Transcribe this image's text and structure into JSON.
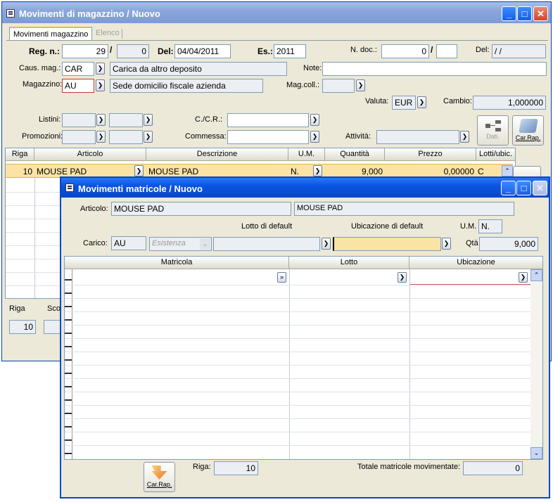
{
  "main": {
    "title": "Movimenti di magazzino / Nuovo",
    "tabs": [
      "Movimenti magazzino",
      "Elenco"
    ],
    "reg_n_label": "Reg. n.:",
    "reg_n": "29",
    "reg_sep": "/",
    "reg_n2": "0",
    "del_label": "Del:",
    "del_date": "04/04/2011",
    "es_label": "Es.:",
    "es": "2011",
    "ndoc_label": "N. doc.:",
    "ndoc": "0",
    "ndoc_sep": "/",
    "ndoc2": "",
    "del2_label": "Del:",
    "del2": "/ /",
    "caus_label": "Caus. mag.:",
    "caus_code": "CAR",
    "caus_desc": "Carica da altro deposito",
    "note_label": "Note:",
    "note": "",
    "magazzino_label": "Magazzino:",
    "magazzino_code": "AU",
    "magazzino_desc": "Sede domicilio fiscale azienda",
    "magcoll_label": "Mag.coll.:",
    "magcoll": "",
    "valuta_label": "Valuta:",
    "valuta": "EUR",
    "cambio_label": "Cambio:",
    "cambio": "1,000000",
    "listini_label": "Listini:",
    "promozioni_label": "Promozioni:",
    "ccr_label": "C./C.R.:",
    "commessa_label": "Commessa:",
    "attivita_label": "Attività:",
    "dati_label": "Dati.",
    "carrap_label": "Car.Rap.",
    "columns": [
      "Riga",
      "Articolo",
      "Descrizione",
      "U.M.",
      "Quantità",
      "Prezzo",
      "Lotti/ubic."
    ],
    "row": {
      "riga": "10",
      "articolo": "MOUSE PAD",
      "descrizione": "MOUSE PAD",
      "um": "N.",
      "quantita": "9,000",
      "prezzo": "0,00000",
      "lotti": "C"
    },
    "bottom_riga_label": "Riga",
    "bottom_sco_label": "Sco",
    "bottom_riga": "10"
  },
  "dialog": {
    "title": "Movimenti matricole / Nuovo",
    "articolo_label": "Articolo:",
    "articolo": "MOUSE PAD",
    "articolo_desc": "MOUSE PAD",
    "lotto_default_label": "Lotto di default",
    "ubicazione_default_label": "Ubicazione di default",
    "um_label": "U.M.",
    "um": "N.",
    "carico_label": "Carico:",
    "carico": "AU",
    "esistenza": "Esistenza",
    "qta_label": "Qtà",
    "qta": "9,000",
    "columns": [
      "Matricola",
      "Lotto",
      "Ubicazione"
    ],
    "riga_label": "Riga:",
    "riga": "10",
    "totale_label": "Totale matricole movimentate:",
    "totale": "0",
    "carrap_label": "Car.Rap."
  }
}
